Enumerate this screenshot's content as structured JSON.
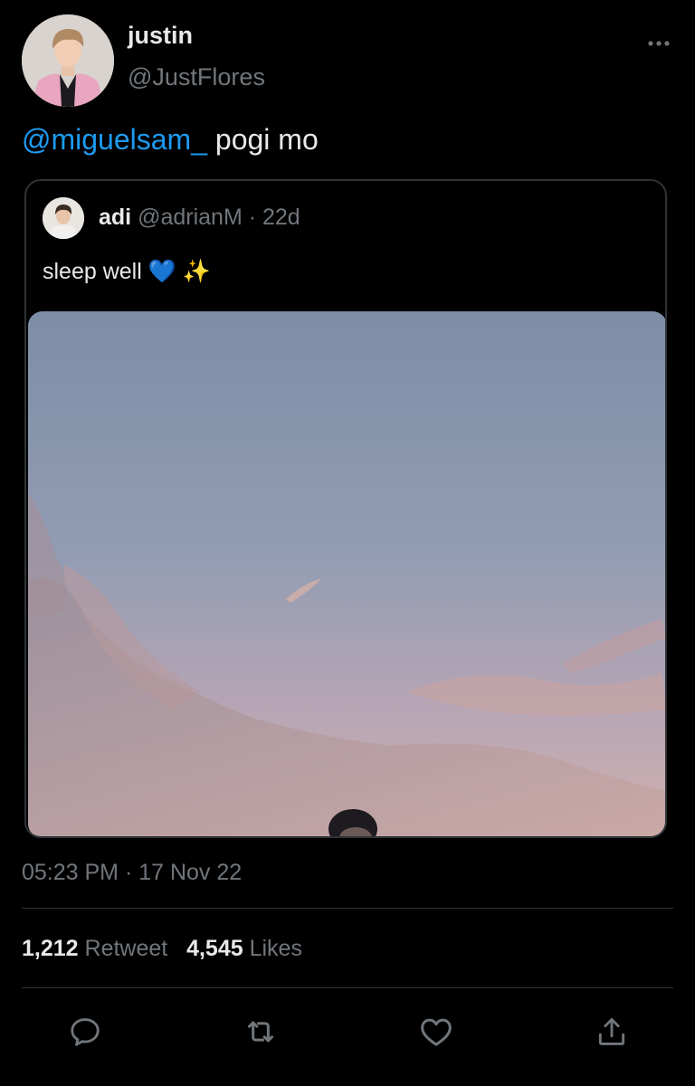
{
  "author": {
    "display_name": "justin",
    "handle": "@JustFlores"
  },
  "tweet": {
    "mention": "@miguelsam_",
    "text": " pogi mo",
    "timestamp": "05:23 PM · 17 Nov 22"
  },
  "quoted": {
    "display_name": "adi",
    "handle": "@adrianM",
    "age": " · 22d",
    "text": "sleep well ",
    "emoji_heart": "💙",
    "emoji_sparkles": "✨"
  },
  "stats": {
    "retweets_count": "1,212",
    "retweets_label": "Retweet",
    "likes_count": "4,545",
    "likes_label": "Likes"
  },
  "actions": [
    {
      "icon": "reply-icon"
    },
    {
      "icon": "retweet-icon"
    },
    {
      "icon": "like-icon"
    },
    {
      "icon": "share-icon"
    }
  ],
  "colors": {
    "background": "#000000",
    "text_primary": "#e7e9ea",
    "text_secondary": "#71767b",
    "accent": "#1d9bf0",
    "border": "#2f3336"
  }
}
